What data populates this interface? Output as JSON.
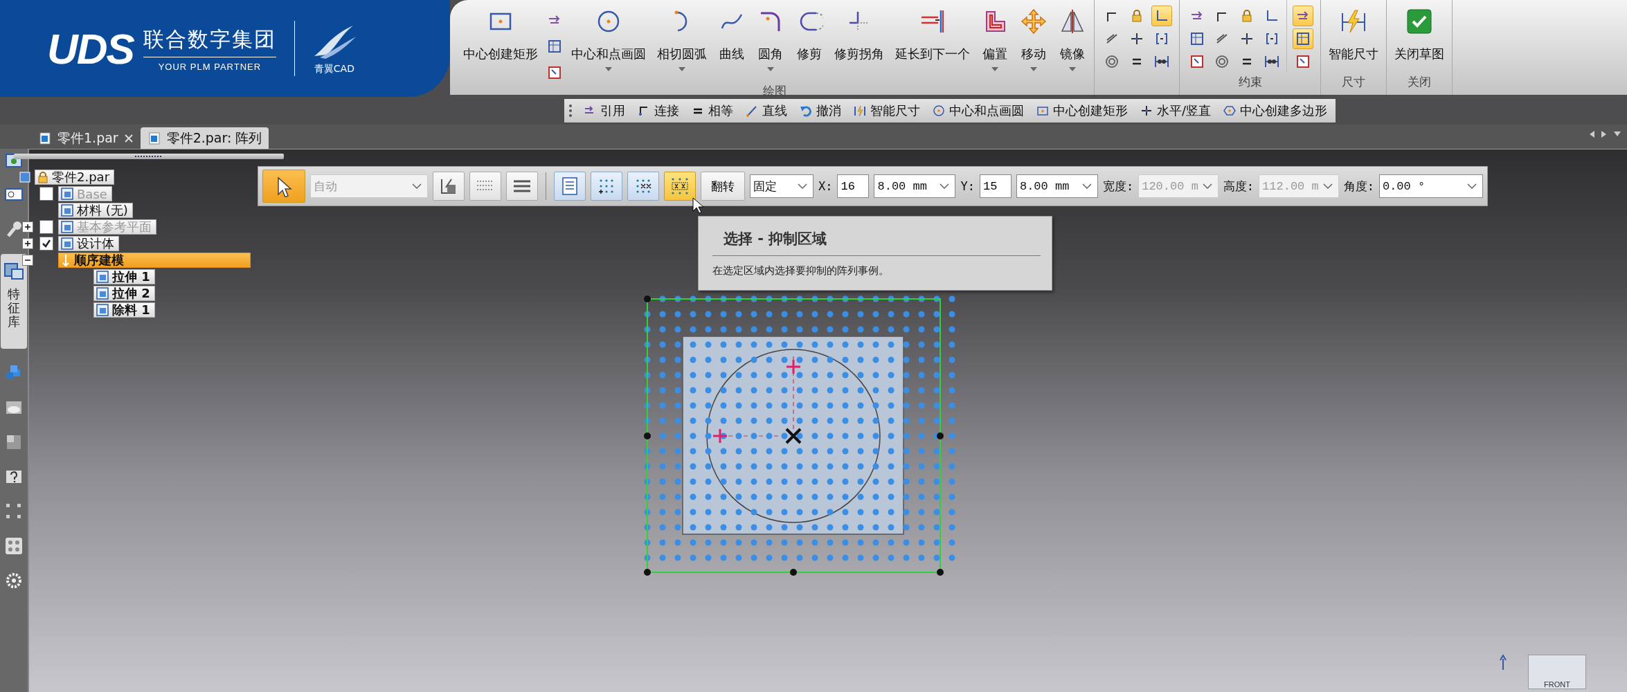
{
  "logo": {
    "brand": "UDS",
    "company": "联合数字集团",
    "tagline": "YOUR PLM PARTNER",
    "product": "青翼CAD"
  },
  "ribbon": {
    "groups": [
      {
        "label": "绘图",
        "tools": [
          {
            "kind": "large",
            "label": "中心创建矩形",
            "dropdown": false
          },
          {
            "kind": "stack",
            "tools": [
              {
                "on": false
              },
              {
                "on": false
              },
              {
                "on": false
              }
            ]
          },
          {
            "kind": "large",
            "label": "中心和点画圆",
            "dropdown": true
          },
          {
            "kind": "large",
            "label": "相切圆弧",
            "dropdown": true
          },
          {
            "kind": "large",
            "label": "曲线",
            "dropdown": false
          },
          {
            "kind": "large",
            "label": "圆角",
            "dropdown": true
          },
          {
            "kind": "large",
            "label": "修剪",
            "dropdown": false
          },
          {
            "kind": "large",
            "label": "修剪拐角",
            "dropdown": false
          },
          {
            "kind": "large",
            "label": "延长到下一个",
            "dropdown": false
          },
          {
            "kind": "large",
            "label": "偏置",
            "dropdown": true
          },
          {
            "kind": "large",
            "label": "移动",
            "dropdown": true
          },
          {
            "kind": "large",
            "label": "镜像",
            "dropdown": true
          }
        ]
      },
      {
        "tools": [
          {
            "kind": "grid",
            "tools": [
              {
                "on": false
              },
              {
                "on": false
              },
              {
                "on": false
              },
              {
                "on": false
              },
              {
                "on": false
              },
              {
                "on": false
              },
              {
                "on": true
              },
              {
                "on": false
              },
              {
                "on": false
              }
            ]
          }
        ]
      },
      {
        "label": "约束",
        "tools": [
          {
            "kind": "grid",
            "tools": [
              {
                "on": false
              },
              {
                "on": false
              },
              {
                "on": false
              },
              {
                "on": false
              },
              {
                "on": false
              },
              {
                "on": false
              },
              {
                "on": false
              },
              {
                "on": false
              },
              {
                "on": false
              },
              {
                "on": false
              },
              {
                "on": false
              },
              {
                "on": false
              }
            ]
          },
          {
            "kind": "grid",
            "tools": [
              {
                "on": true
              },
              {
                "on": true
              },
              {
                "on": false
              }
            ]
          }
        ]
      },
      {
        "label": "尺寸",
        "tools": [
          {
            "kind": "large",
            "label": "智能尺寸",
            "dropdown": false
          }
        ]
      },
      {
        "label": "关闭",
        "tools": [
          {
            "kind": "large",
            "label": "关闭草图",
            "dropdown": false
          }
        ]
      }
    ]
  },
  "quick_toolbar": [
    {
      "label": "引用"
    },
    {
      "label": "连接"
    },
    {
      "label": "相等"
    },
    {
      "label": "直线"
    },
    {
      "label": "撤消"
    },
    {
      "label": "智能尺寸"
    },
    {
      "label": "中心和点画圆"
    },
    {
      "label": "中心创建矩形"
    },
    {
      "label": "水平/竖直"
    },
    {
      "label": "中心创建多边形"
    }
  ],
  "tabs": [
    {
      "label": "零件1.par",
      "selected": false,
      "closable": true
    },
    {
      "label": "零件2.par: 阵列",
      "selected": true,
      "closable": false
    }
  ],
  "side_strip": [
    {
      "kind": "icon",
      "selected": false
    },
    {
      "kind": "icon",
      "selected": false
    },
    {
      "kind": "icon",
      "selected": false
    },
    {
      "kind": "tab",
      "label": "特征库",
      "selected": true
    },
    {
      "kind": "icon",
      "selected": false
    },
    {
      "kind": "icon",
      "selected": false
    },
    {
      "kind": "icon",
      "selected": false
    },
    {
      "kind": "icon",
      "selected": false
    },
    {
      "kind": "icon",
      "selected": false
    },
    {
      "kind": "icon",
      "selected": false
    },
    {
      "kind": "icon",
      "selected": false
    }
  ],
  "tree": {
    "root": {
      "label": "零件2.par",
      "children": [
        {
          "label": "Base",
          "checked": false,
          "dimmed": true,
          "selected": false
        },
        {
          "label": "材料 (无)",
          "dimmed": false,
          "selected": false
        },
        {
          "label": "基本参考平面",
          "expanded": false,
          "checked": false,
          "dimmed": true,
          "selected": false
        },
        {
          "label": "设计体",
          "expanded": false,
          "checked": true,
          "dimmed": false,
          "selected": false
        },
        {
          "label": "顺序建模",
          "expanded": true,
          "dimmed": false,
          "selected": true,
          "children": [
            {
              "label": "拉伸 1",
              "selected": false
            },
            {
              "label": "拉伸 2",
              "selected": false
            },
            {
              "label": "除料 1",
              "selected": false
            }
          ]
        }
      ]
    }
  },
  "command_bar": {
    "items": [
      {
        "kind": "tool",
        "selected": true
      },
      {
        "kind": "dropdown",
        "value": "自动",
        "disabled": true
      },
      {
        "kind": "tool",
        "selected": false
      },
      {
        "kind": "tool",
        "selected": false
      },
      {
        "kind": "tool",
        "selected": false
      },
      {
        "kind": "separator"
      },
      {
        "kind": "toggle",
        "selected": false
      },
      {
        "kind": "toggle",
        "selected": false
      },
      {
        "kind": "toggle",
        "selected": false
      },
      {
        "kind": "toggle",
        "selected": true
      },
      {
        "kind": "button",
        "label": "翻转"
      },
      {
        "kind": "dropdown",
        "value": "固定",
        "disabled": false
      },
      {
        "kind": "label",
        "text": "X:"
      },
      {
        "kind": "input",
        "value": "16"
      },
      {
        "kind": "dropdown",
        "value": "8.00 mm",
        "disabled": false
      },
      {
        "kind": "label",
        "text": "Y:"
      },
      {
        "kind": "input",
        "value": "15"
      },
      {
        "kind": "dropdown",
        "value": "8.00 mm",
        "disabled": false
      },
      {
        "kind": "label",
        "text": "宽度:"
      },
      {
        "kind": "dropdown",
        "value": "120.00 m",
        "disabled": true
      },
      {
        "kind": "label",
        "text": "高度:"
      },
      {
        "kind": "dropdown",
        "value": "112.00 m",
        "disabled": true
      },
      {
        "kind": "label",
        "text": "角度:"
      },
      {
        "kind": "dropdown",
        "value": "0.00 °",
        "disabled": false
      }
    ]
  },
  "tooltip": {
    "title": "选择 - 抑制区域",
    "description": "在选定区域内选择要抑制的阵列事例。"
  },
  "view_cube": {
    "label": "FRONT"
  }
}
